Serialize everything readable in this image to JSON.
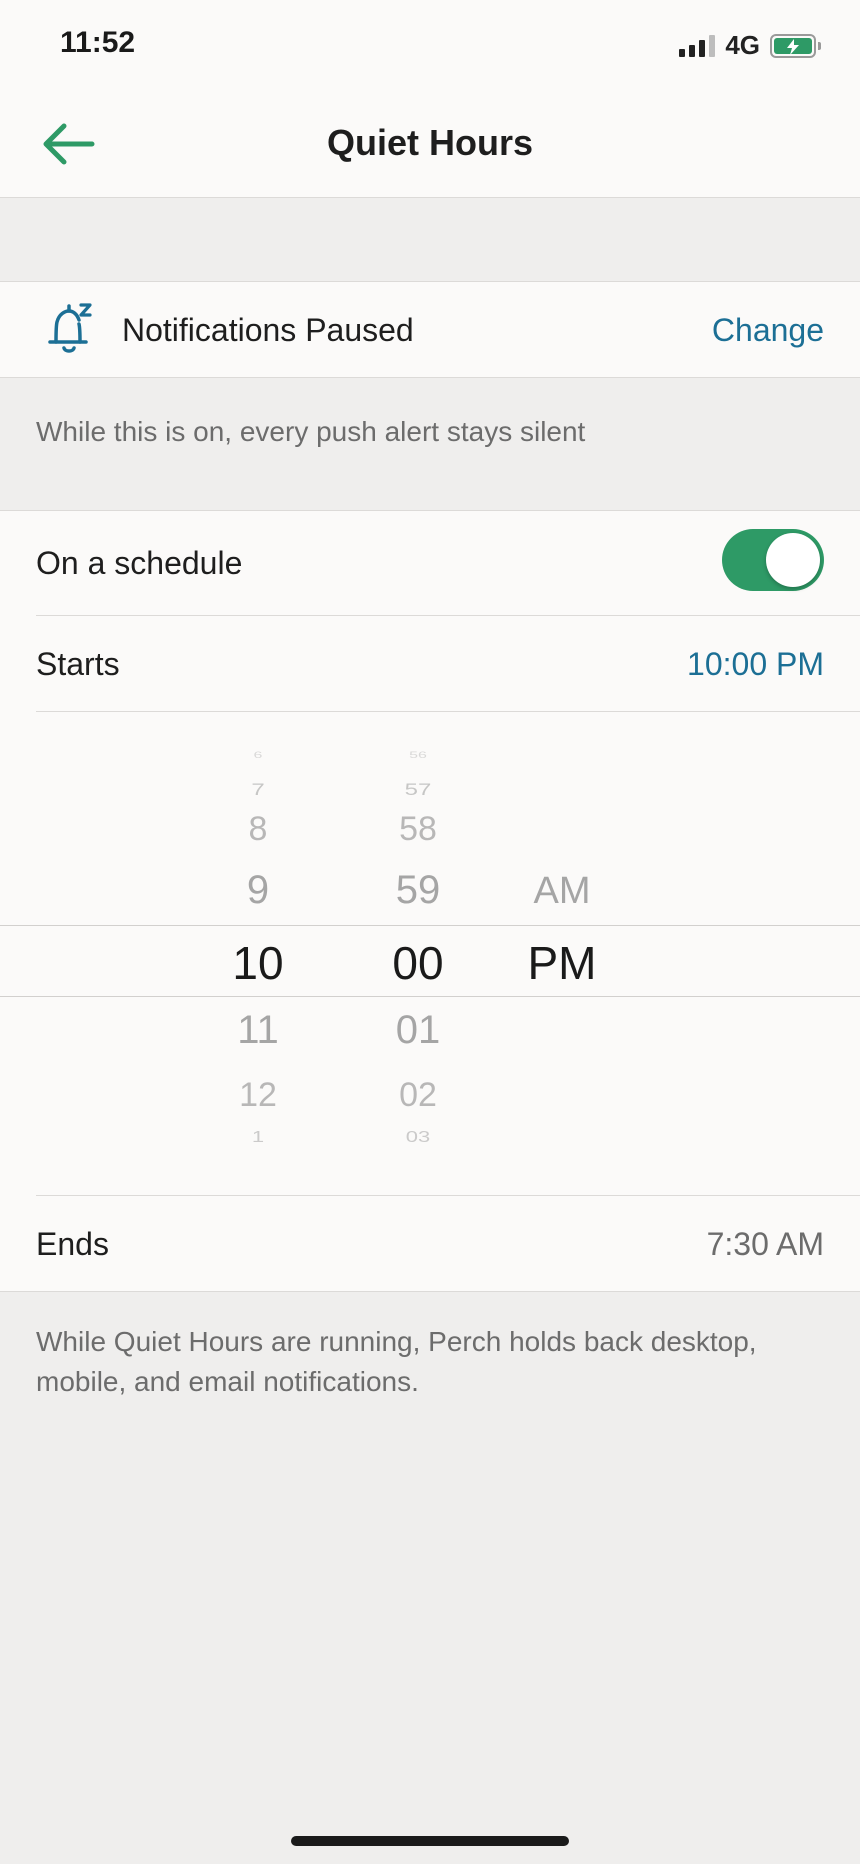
{
  "status_bar": {
    "time": "11:52",
    "network": "4G"
  },
  "header": {
    "title": "Quiet Hours",
    "back_icon": "arrow-left-icon"
  },
  "colors": {
    "accent_green": "#2e9a66",
    "link_blue": "#1c6f95",
    "background": "#efeeed",
    "surface": "#fbfaf9"
  },
  "notifications": {
    "status_label": "Notifications Paused",
    "icon": "bell-snooze-icon",
    "change_label": "Change",
    "note": "While this is on, every push alert stays silent"
  },
  "schedule": {
    "toggle_label": "On a schedule",
    "toggle_on": true,
    "starts_label": "Starts",
    "starts_value": "10:00 PM",
    "ends_label": "Ends",
    "ends_value": "7:30 AM"
  },
  "time_picker": {
    "hours": [
      "6",
      "7",
      "8",
      "9",
      "10",
      "11",
      "12",
      "1"
    ],
    "minutes": [
      "56",
      "57",
      "58",
      "59",
      "00",
      "01",
      "02",
      "03"
    ],
    "periods": [
      "AM",
      "PM"
    ],
    "selected_hour": "10",
    "selected_minute": "00",
    "selected_period": "PM"
  },
  "footer_note": "While Quiet Hours are running, Perch holds back desktop, mobile, and email notifications."
}
